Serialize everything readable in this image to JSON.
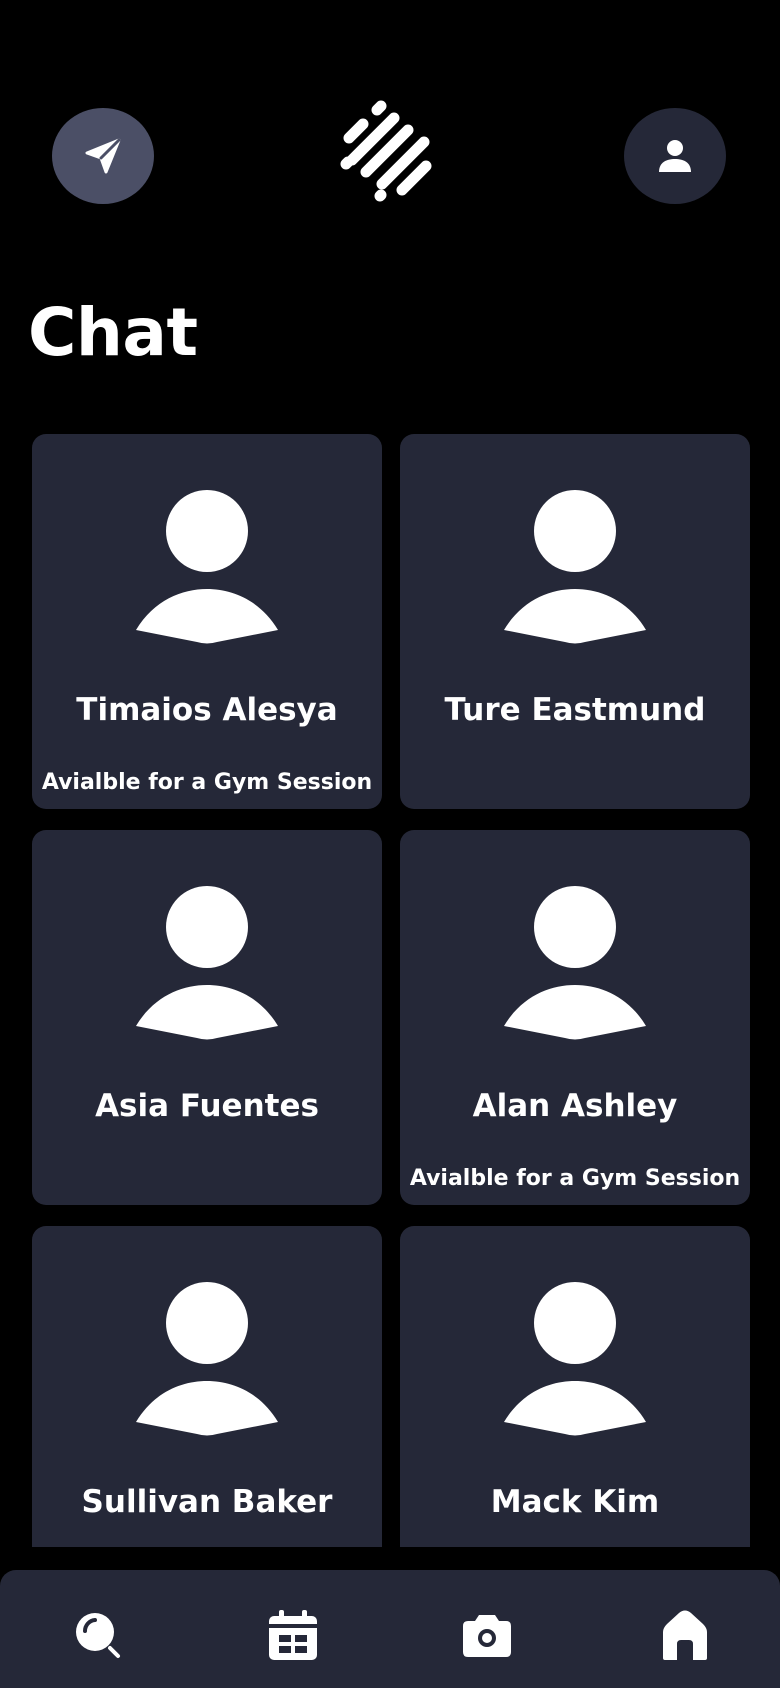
{
  "page": {
    "title": "Chat"
  },
  "colors": {
    "background": "#000000",
    "card": "#252838",
    "send_button": "#4b4f66",
    "profile_button": "#252838",
    "text": "#ffffff"
  },
  "header": {
    "left_icon": "send-icon",
    "center_icon": "logo-icon",
    "right_icon": "user-icon"
  },
  "contacts": [
    {
      "name": "Timaios Alesya",
      "status": "Avialble for a Gym Session"
    },
    {
      "name": "Ture Eastmund",
      "status": ""
    },
    {
      "name": "Asia Fuentes",
      "status": ""
    },
    {
      "name": "Alan Ashley",
      "status": "Avialble for a Gym Session"
    },
    {
      "name": "Sullivan Baker",
      "status": ""
    },
    {
      "name": "Mack Kim",
      "status": ""
    }
  ],
  "bottom_nav": {
    "items": [
      {
        "icon": "search-icon"
      },
      {
        "icon": "calendar-icon"
      },
      {
        "icon": "camera-icon"
      },
      {
        "icon": "home-icon"
      }
    ]
  }
}
